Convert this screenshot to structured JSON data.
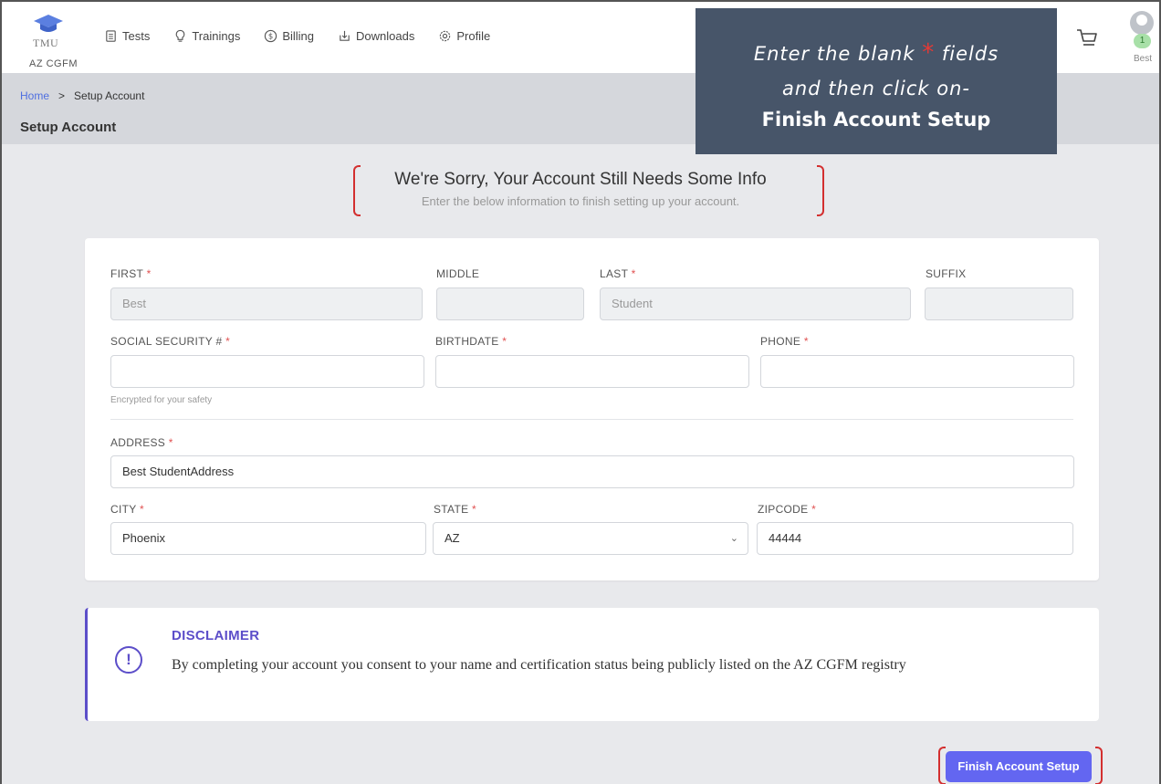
{
  "nav": {
    "logo_text": "TMU",
    "logo_sub": "AZ CGFM",
    "items": [
      {
        "label": "Tests",
        "icon": "clipboard-icon"
      },
      {
        "label": "Trainings",
        "icon": "lightbulb-icon"
      },
      {
        "label": "Billing",
        "icon": "dollar-circle-icon"
      },
      {
        "label": "Downloads",
        "icon": "download-icon"
      },
      {
        "label": "Profile",
        "icon": "gear-icon"
      }
    ],
    "cart_count": "1",
    "user_name": "Best"
  },
  "breadcrumb": {
    "home": "Home",
    "sep": ">",
    "current": "Setup Account"
  },
  "page_title": "Setup Account",
  "annotation": {
    "line1_a": "Enter the blank",
    "star": "*",
    "line1_b": "fields",
    "line2": "and then click on-",
    "line3": "Finish Account Setup"
  },
  "headline": {
    "title": "We're Sorry, Your Account Still Needs Some Info",
    "subtitle": "Enter the below information to finish setting up your account."
  },
  "form": {
    "first": {
      "label": "FIRST",
      "value": "Best"
    },
    "middle": {
      "label": "MIDDLE",
      "value": ""
    },
    "last": {
      "label": "LAST",
      "value": "Student"
    },
    "suffix": {
      "label": "SUFFIX",
      "value": ""
    },
    "ssn": {
      "label": "SOCIAL SECURITY #",
      "value": "",
      "hint": "Encrypted for your safety"
    },
    "birthdate": {
      "label": "BIRTHDATE",
      "value": ""
    },
    "phone": {
      "label": "PHONE",
      "value": ""
    },
    "address": {
      "label": "ADDRESS",
      "value": "Best StudentAddress"
    },
    "city": {
      "label": "CITY",
      "value": "Phoenix"
    },
    "state": {
      "label": "STATE",
      "value": "AZ"
    },
    "zipcode": {
      "label": "ZIPCODE",
      "value": "44444"
    },
    "required_mark": "*"
  },
  "disclaimer": {
    "icon_glyph": "!",
    "title": "DISCLAIMER",
    "text": "By completing your account you consent to your name and certification status being publicly listed on the AZ CGFM registry"
  },
  "finish_button": "Finish Account Setup",
  "colors": {
    "accent": "#6366f1",
    "disclaimer": "#5c4ec9",
    "required": "#e05252",
    "annotation_bg": "#475569",
    "highlight": "#d32f2f"
  }
}
